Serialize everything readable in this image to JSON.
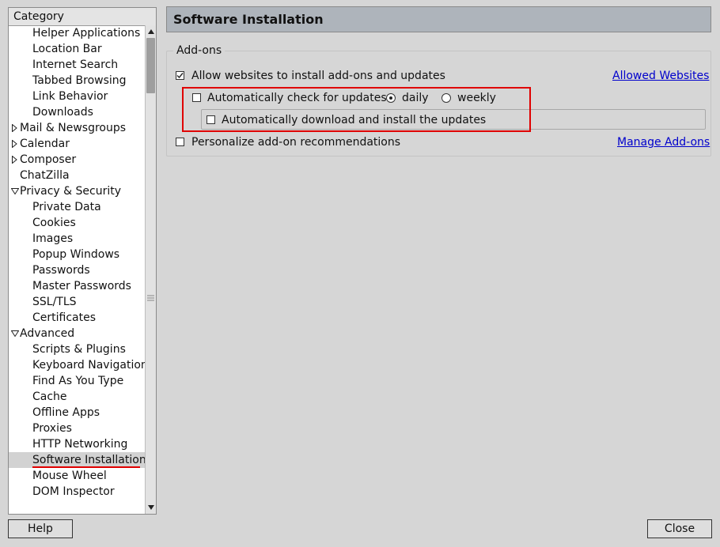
{
  "sidebar": {
    "header": "Category",
    "items": [
      {
        "label": "Helper Applications",
        "level": 1
      },
      {
        "label": "Location Bar",
        "level": 1
      },
      {
        "label": "Internet Search",
        "level": 1
      },
      {
        "label": "Tabbed Browsing",
        "level": 1
      },
      {
        "label": "Link Behavior",
        "level": 1
      },
      {
        "label": "Downloads",
        "level": 1
      },
      {
        "label": "Mail & Newsgroups",
        "level": 0,
        "expander": "collapsed"
      },
      {
        "label": "Calendar",
        "level": 0,
        "expander": "collapsed"
      },
      {
        "label": "Composer",
        "level": 0,
        "expander": "collapsed"
      },
      {
        "label": "ChatZilla",
        "level": 0,
        "expander": "none"
      },
      {
        "label": "Privacy & Security",
        "level": 0,
        "expander": "expanded"
      },
      {
        "label": "Private Data",
        "level": 1
      },
      {
        "label": "Cookies",
        "level": 1
      },
      {
        "label": "Images",
        "level": 1
      },
      {
        "label": "Popup Windows",
        "level": 1
      },
      {
        "label": "Passwords",
        "level": 1
      },
      {
        "label": "Master Passwords",
        "level": 1
      },
      {
        "label": "SSL/TLS",
        "level": 1
      },
      {
        "label": "Certificates",
        "level": 1
      },
      {
        "label": "Advanced",
        "level": 0,
        "expander": "expanded"
      },
      {
        "label": "Scripts & Plugins",
        "level": 1
      },
      {
        "label": "Keyboard Navigation",
        "level": 1
      },
      {
        "label": "Find As You Type",
        "level": 1
      },
      {
        "label": "Cache",
        "level": 1
      },
      {
        "label": "Offline Apps",
        "level": 1
      },
      {
        "label": "Proxies",
        "level": 1
      },
      {
        "label": "HTTP Networking",
        "level": 1
      },
      {
        "label": "Software Installation",
        "level": 1,
        "selected": true
      },
      {
        "label": "Mouse Wheel",
        "level": 1
      },
      {
        "label": "DOM Inspector",
        "level": 1
      }
    ]
  },
  "panel": {
    "title": "Software Installation",
    "group_caption": "Add-ons",
    "allow_label": "Allow websites to install add-ons and updates",
    "allow_checked": true,
    "allowed_websites_link": "Allowed Websites",
    "auto_check_label": "Automatically check for updates",
    "auto_check_checked": false,
    "daily_label": "daily",
    "weekly_label": "weekly",
    "frequency_selected": "daily",
    "auto_download_label": "Automatically download and install the updates",
    "auto_download_checked": false,
    "personalize_label": "Personalize add-on recommendations",
    "personalize_checked": false,
    "manage_addons_link": "Manage Add-ons"
  },
  "buttons": {
    "help": "Help",
    "close": "Close"
  },
  "colors": {
    "highlight": "#e00000",
    "link": "#0000cc",
    "title_bar": "#aeb4bb"
  }
}
